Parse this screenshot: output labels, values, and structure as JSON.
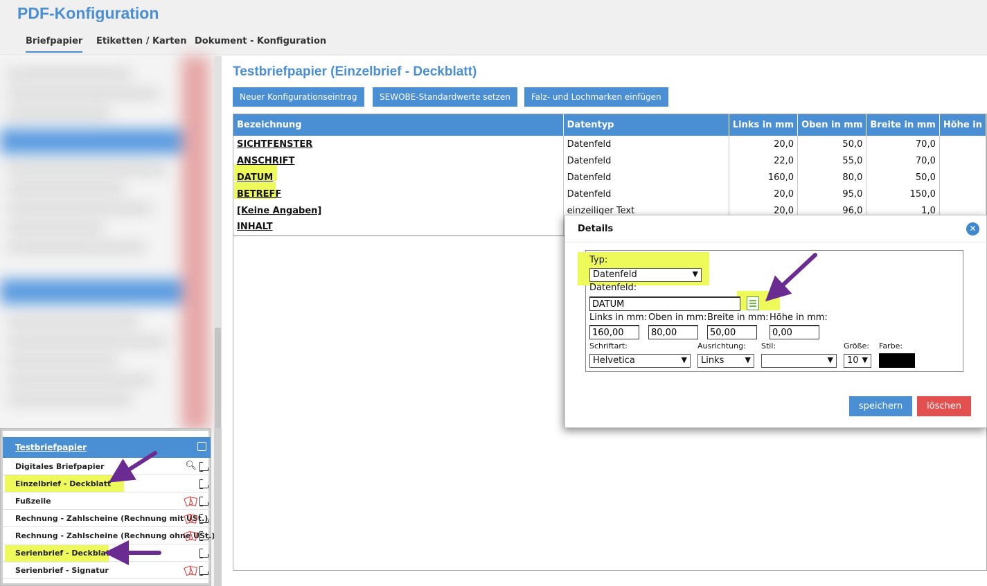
{
  "app": {
    "title": "PDF-Konfiguration"
  },
  "tabs": [
    {
      "label": "Briefpapier",
      "active": true
    },
    {
      "label": "Etiketten / Karten",
      "active": false
    },
    {
      "label": "Dokument - Konfiguration",
      "active": false
    }
  ],
  "tree": {
    "header": "Testbriefpapier",
    "items": [
      {
        "label": "Digitales Briefpapier",
        "icons": [
          "search-icon",
          "ruler-icon"
        ],
        "highlighted": false
      },
      {
        "label": "Einzelbrief - Deckblatt",
        "icons": [
          "ruler-icon"
        ],
        "highlighted": true
      },
      {
        "label": "Fußzeile",
        "icons": [
          "pdf-icon",
          "ruler-icon"
        ],
        "highlighted": false
      },
      {
        "label": "Rechnung - Zahlscheine (Rechnung mit USt.)",
        "icons": [
          "pdf-icon",
          "ruler-icon"
        ],
        "highlighted": false
      },
      {
        "label": "Rechnung - Zahlscheine (Rechnung ohne USt.)",
        "icons": [
          "pdf-icon",
          "ruler-icon"
        ],
        "highlighted": false
      },
      {
        "label": "Serienbrief - Deckblatt",
        "icons": [
          "ruler-icon"
        ],
        "highlighted": true
      },
      {
        "label": "Serienbrief - Signatur",
        "icons": [
          "pdf-icon",
          "ruler-icon"
        ],
        "highlighted": false
      }
    ]
  },
  "main": {
    "title": "Testbriefpapier (Einzelbrief - Deckblatt)",
    "buttons": {
      "new_entry": "Neuer Konfigurationseintrag",
      "defaults": "SEWOBE-Standardwerte setzen",
      "marks": "Falz- und Lochmarken einfügen"
    },
    "table": {
      "columns": [
        "Bezeichnung",
        "Datentyp",
        "Links in mm",
        "Oben in mm",
        "Breite in mm",
        "Höhe in"
      ],
      "rows": [
        {
          "name": "SICHTFENSTER",
          "type": "Datenfeld",
          "links": "20,0",
          "oben": "50,0",
          "breite": "70,0"
        },
        {
          "name": "ANSCHRIFT",
          "type": "Datenfeld",
          "links": "22,0",
          "oben": "55,0",
          "breite": "70,0"
        },
        {
          "name": "DATUM",
          "type": "Datenfeld",
          "links": "160,0",
          "oben": "80,0",
          "breite": "50,0"
        },
        {
          "name": "BETREFF",
          "type": "Datenfeld",
          "links": "20,0",
          "oben": "95,0",
          "breite": "150,0"
        },
        {
          "name": "[Keine Angaben]",
          "type": "einzeiliger Text",
          "links": "20,0",
          "oben": "96,0",
          "breite": "1,0"
        },
        {
          "name": "INHALT",
          "type": "",
          "links": "",
          "oben": "",
          "breite": ""
        }
      ]
    }
  },
  "dialog": {
    "title": "Details",
    "close": "✕",
    "typ_label": "Typ:",
    "typ_value": "Datenfeld",
    "datenfeld_label": "Datenfeld:",
    "datenfeld_value": "DATUM",
    "links_label": "Links in mm:",
    "links_value": "160,00",
    "oben_label": "Oben in mm:",
    "oben_value": "80,00",
    "breite_label": "Breite in mm:",
    "breite_value": "50,00",
    "hoehe_label": "Höhe in mm:",
    "hoehe_value": "0,00",
    "schriftart_label": "Schriftart:",
    "schriftart_value": "Helvetica",
    "ausrichtung_label": "Ausrichtung:",
    "ausrichtung_value": "Links",
    "stil_label": "Stil:",
    "stil_value": "",
    "groesse_label": "Größe:",
    "groesse_value": "10",
    "farbe_label": "Farbe:",
    "farbe_value": "#000000",
    "save": "speichern",
    "delete": "löschen"
  },
  "colors": {
    "accent": "#4a8ed4",
    "highlight": "#eef95a",
    "arrow": "#6a2c91",
    "delete": "#e35050"
  }
}
